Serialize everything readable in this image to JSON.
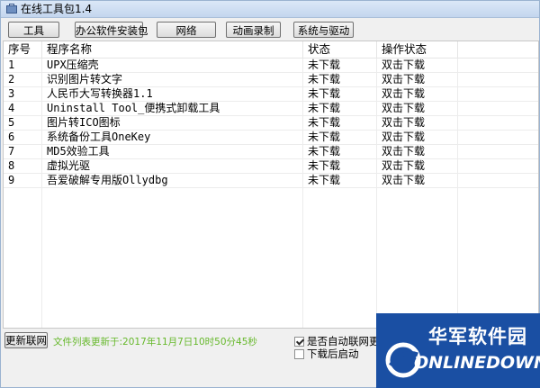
{
  "window": {
    "title": "在线工具包1.4"
  },
  "toolbar": {
    "buttons": [
      "工具",
      "办公软件安装包",
      "网络",
      "动画录制",
      "系统与驱动"
    ]
  },
  "table": {
    "columns": [
      "序号",
      "程序名称",
      "状态",
      "操作状态"
    ],
    "rows": [
      [
        "1",
        "UPX压缩壳",
        "未下载",
        "双击下载"
      ],
      [
        "2",
        "识别图片转文字",
        "未下载",
        "双击下载"
      ],
      [
        "3",
        "人民币大写转换器1.1",
        "未下载",
        "双击下载"
      ],
      [
        "4",
        "Uninstall Tool_便携式卸载工具",
        "未下载",
        "双击下载"
      ],
      [
        "5",
        "图片转ICO图标",
        "未下载",
        "双击下载"
      ],
      [
        "6",
        "系统备份工具OneKey",
        "未下载",
        "双击下载"
      ],
      [
        "7",
        "MD5效验工具",
        "未下载",
        "双击下载"
      ],
      [
        "8",
        "虚拟光驱",
        "未下载",
        "双击下载"
      ],
      [
        "9",
        "吾爱破解专用版Ollydbg",
        "未下载",
        "双击下载"
      ]
    ]
  },
  "footer": {
    "update_button": "更新联网",
    "update_status": "文件列表更新于:2017年11月7日10时50分45秒",
    "auto_update_label": "是否自动联网更新",
    "auto_update_checked": true,
    "launch_after_download_label": "下载后启动",
    "launch_after_download_checked": false
  },
  "watermark": {
    "cn": "华军软件园",
    "en": "ONLINEDOWN.NET"
  },
  "colors": {
    "title_bar": "#c3d6ee",
    "status_text": "#66b82b",
    "watermark_bg": "#1a4fa3"
  }
}
